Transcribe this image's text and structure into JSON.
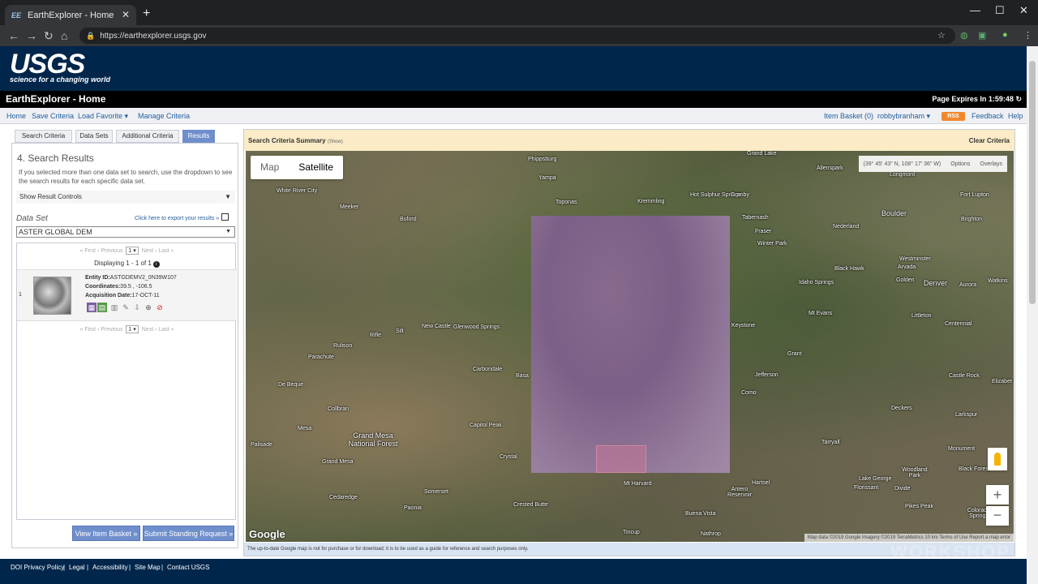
{
  "browser": {
    "tab_title": "EarthExplorer - Home",
    "tab_favicon": "EE",
    "url": "https://earthexplorer.usgs.gov"
  },
  "header": {
    "logo": "USGS",
    "tagline": "science for a changing world",
    "title": "EarthExplorer - Home",
    "expires": "Page Expires In 1:59:48"
  },
  "menu": {
    "home": "Home",
    "save": "Save Criteria",
    "load": "Load Favorite",
    "manage": "Manage Criteria",
    "basket": "Item Basket (0)",
    "user": "robbybranham",
    "rss": "RSS",
    "feedback": "Feedback",
    "help": "Help"
  },
  "left": {
    "tabs": [
      "Search Criteria",
      "Data Sets",
      "Additional Criteria",
      "Results"
    ],
    "title": "4. Search Results",
    "desc": "If you selected more than one data set to search, use the dropdown to see the search results for each specific data set.",
    "show_controls": "Show Result Controls",
    "dataset_label": "Data Set",
    "export": "Click here to export your results »",
    "dataset_value": "ASTER GLOBAL DEM",
    "pager": {
      "first": "« First",
      "prev": "‹ Previous",
      "page": "1",
      "next": "Next ›",
      "last": "Last »"
    },
    "displaying": "Displaying 1 - 1 of 1",
    "result": {
      "num": "1",
      "entity_label": "Entity ID:",
      "entity": "ASTGDEMV2_0N39W107",
      "coord_label": "Coordinates:",
      "coords": "39.5 , -106.5",
      "date_label": "Acquisition Date:",
      "date": "17-OCT-11"
    },
    "view_basket": "View Item Basket »",
    "submit": "Submit Standing Request »"
  },
  "map": {
    "summary": "Search Criteria Summary",
    "summary_show": "(Show)",
    "clear": "Clear Criteria",
    "toggle_map": "Map",
    "toggle_sat": "Satellite",
    "coords": "(39° 45' 43\" N, 108° 17' 36\" W)",
    "options": "Options",
    "overlays": "Overlays",
    "google": "Google",
    "attribution": "Map data ©2019 Google Imagery ©2019 TerraMetrics   10 km   Terms of Use   Report a map error",
    "disclaimer": "The up-to-date Google map is not for purchase or for download; it is to be used as a guide for reference and search purposes only.",
    "places": {
      "phippsburg": "Phippsburg",
      "yampa": "Yampa",
      "toponas": "Toponas",
      "kremmling": "Kremmling",
      "hotsulphur": "Hot Sulphur Springs",
      "granby": "Granby",
      "grandlake": "Grand Lake",
      "allenspark": "Allenspark",
      "longmont": "Longmont",
      "whiteriver": "White River City",
      "meeker": "Meeker",
      "buford": "Buford",
      "tabernash": "Tabernash",
      "fraser": "Fraser",
      "winterpark": "Winter Park",
      "nederland": "Nederland",
      "boulder": "Boulder",
      "fortlupton": "Fort Lupton",
      "brighton": "Brighton",
      "westminster": "Westminster",
      "arvada": "Arvada",
      "golden": "Golden",
      "denver": "Denver",
      "aurora": "Aurora",
      "watkins": "Watkins",
      "blackhawk": "Black Hawk",
      "idaho": "Idaho Springs",
      "mtevans": "Mt Evans",
      "keystone": "Keystone",
      "littleton": "Littleton",
      "centennial": "Centennial",
      "rifle": "Rifle",
      "silt": "Silt",
      "newcastle": "New Castle",
      "glenwood": "Glenwood Springs",
      "rulison": "Rulison",
      "parachute": "Parachute",
      "carbondale": "Carbondale",
      "basalt": "Basa",
      "grant": "Grant",
      "jefferson": "Jefferson",
      "castlerock": "Castle Rock",
      "elizabeth": "Elizabet",
      "debeque": "De Beque",
      "collbran": "Collbran",
      "como": "Como",
      "mesa": "Mesa",
      "grandmesa": "Grand Mesa National Forest",
      "capitolpeak": "Capitol Peak",
      "palisade": "Palisade",
      "grandmesa2": "Grand Mesa",
      "crystal": "Crystal",
      "deckers": "Deckers",
      "larkspur": "Larkspur",
      "monument": "Monument",
      "tarryall": "Tarryall",
      "woodland": "Woodland Park",
      "blackforest": "Black Forest",
      "lakegeorge": "Lake George",
      "florissant": "Florissant",
      "divide": "Divide",
      "cedaredge": "Cedaredge",
      "somerset": "Somerset",
      "mtharvard": "Mt Harvard",
      "antero": "Antero Reservoir",
      "hartsel": "Hartsel",
      "crested": "Crested Butte",
      "paonia": "Paonia",
      "buenavista": "Buena Vista",
      "pikespeak": "Pikes Peak",
      "coloradosprings": "Colorado Springs",
      "nathrop": "Nathrop",
      "tincup": "Tincup"
    }
  },
  "footer": {
    "doi": "DOI Privacy Policy",
    "legal": "Legal",
    "access": "Accessibility",
    "sitemap": "Site Map",
    "contact": "Contact USGS",
    "watermark": "WORKSHOP"
  },
  "colors": {
    "header": "#00264c",
    "accent": "#6f8ecc",
    "summary_bg": "#fbecc7",
    "overlay": "#8a6a92"
  }
}
